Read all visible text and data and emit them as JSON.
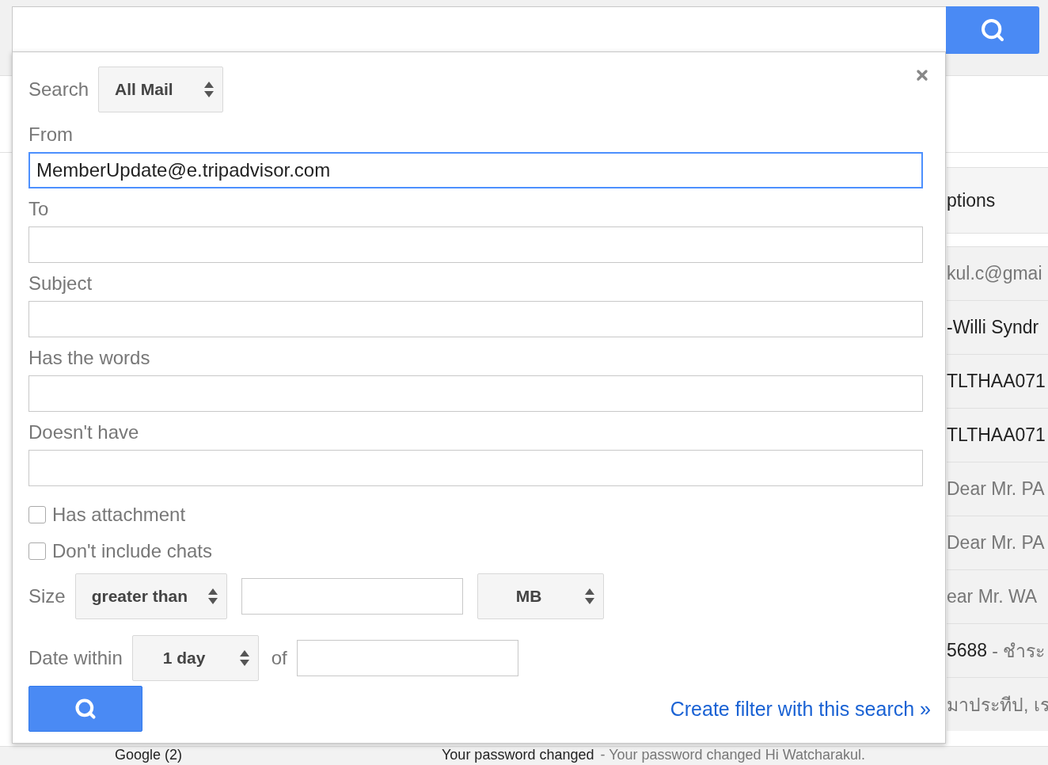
{
  "background": {
    "options_header": "ptions",
    "rows": [
      {
        "snippet": "kul.c@gmai"
      },
      {
        "subject": "-Willi Syndr"
      },
      {
        "subject": "TLTHAA071"
      },
      {
        "subject": "TLTHAA071"
      },
      {
        "snippet": "Dear Mr. PA"
      },
      {
        "snippet": "Dear Mr. PA"
      },
      {
        "snippet": "ear Mr. WA"
      },
      {
        "subject": "5688",
        "snippet": "- ชำระ"
      },
      {
        "snippet": "มาประทีป, เร"
      }
    ],
    "bottom_row": {
      "sender": "Google (2)",
      "subject": "Your password changed",
      "snippet": "- Your password changed Hi Watcharakul."
    }
  },
  "dialog": {
    "search_label": "Search",
    "scope": "All Mail",
    "fields": [
      {
        "label": "From",
        "value": "MemberUpdate@e.tripadvisor.com",
        "focused": true
      },
      {
        "label": "To",
        "focused": false
      },
      {
        "label": "Subject",
        "focused": false
      },
      {
        "label": "Has the words",
        "focused": false
      },
      {
        "label": "Doesn't have",
        "focused": false
      }
    ],
    "checkboxes": [
      {
        "label": "Has attachment",
        "checked": false
      },
      {
        "label": "Don't include chats",
        "checked": false
      }
    ],
    "size": {
      "label": "Size",
      "operator": "greater than",
      "unit": "MB"
    },
    "date": {
      "label": "Date within",
      "range": "1 day",
      "of_label": "of"
    },
    "create_filter_link": "Create filter with this search »"
  }
}
